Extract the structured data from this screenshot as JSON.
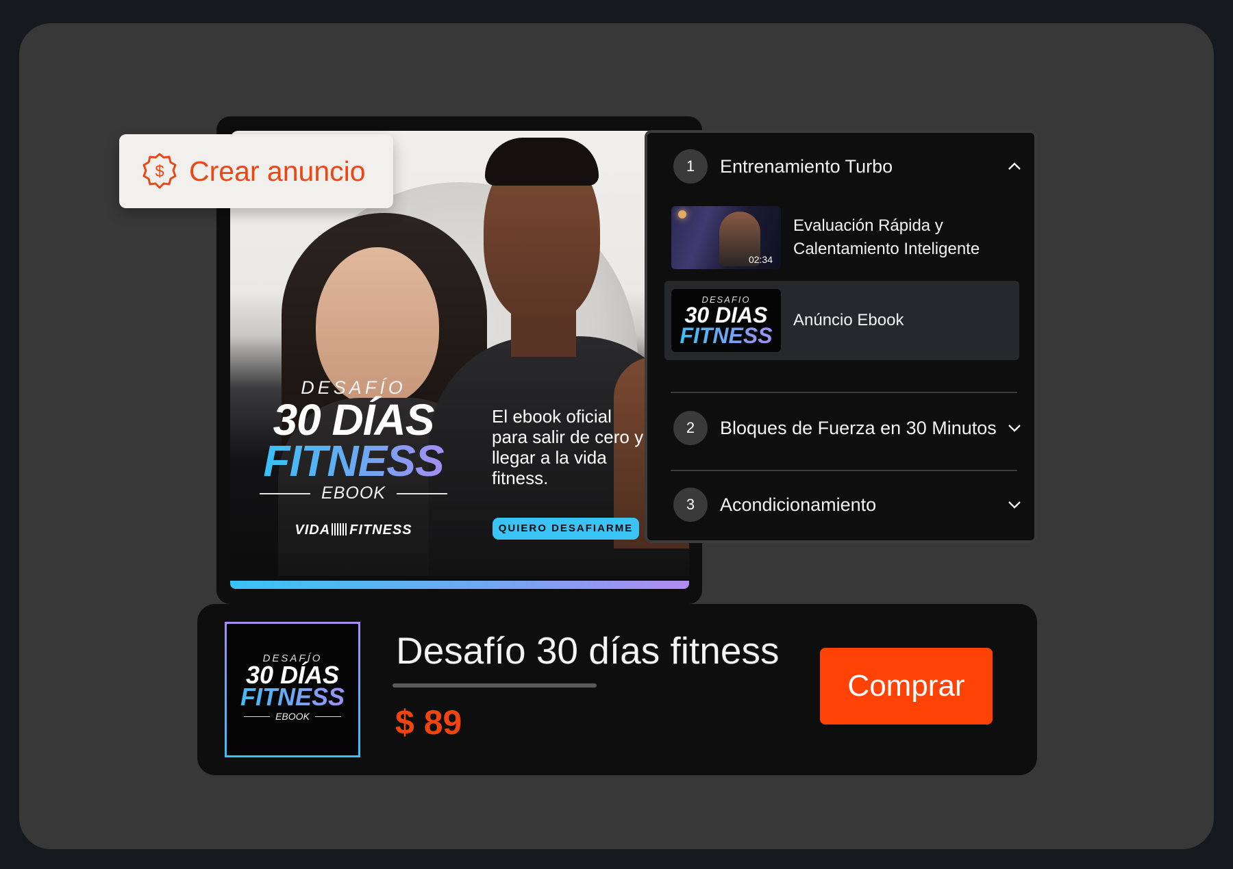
{
  "chip": {
    "label": "Crear anuncio",
    "icon": "dollar-badge-icon",
    "color": "#ee4512"
  },
  "ad": {
    "desafio": "DESAFÍO",
    "title_line1": "30 DÍAS",
    "title_line2": "FITNESS",
    "subtitle": "EBOOK",
    "brand_left": "VIDA",
    "brand_right": "FITNESS",
    "copy": "El ebook oficial para salir de cero y llegar a la vida fitness.",
    "cta": "QUIERO DESAFIARME",
    "cta_color": "#3ac4f6"
  },
  "course": {
    "modules": [
      {
        "number": "1",
        "title": "Entrenamiento Turbo",
        "chevron": "chevron-up-icon"
      },
      {
        "number": "2",
        "title": "Bloques de Fuerza en 30 Minutos",
        "chevron": "chevron-down-icon"
      },
      {
        "number": "3",
        "title": "Acondicionamiento",
        "chevron": "chevron-down-icon"
      }
    ],
    "lessons": [
      {
        "title": "Evaluación Rápida y Calentamiento Inteligente",
        "duration": "02:34"
      },
      {
        "title": "Anúncio Ebook",
        "thumb_line1": "DESAFIO",
        "thumb_line2": "30 DIAS",
        "thumb_line3": "FITNESS"
      }
    ]
  },
  "product": {
    "cover_line1": "DESAFÍO",
    "cover_line2": "30 DÍAS",
    "cover_line3": "FITNESS",
    "cover_line4": "EBOOK",
    "name": "Desafío 30 días fitness",
    "price": "$ 89",
    "buy_label": "Comprar",
    "buy_color": "#ff4307"
  }
}
